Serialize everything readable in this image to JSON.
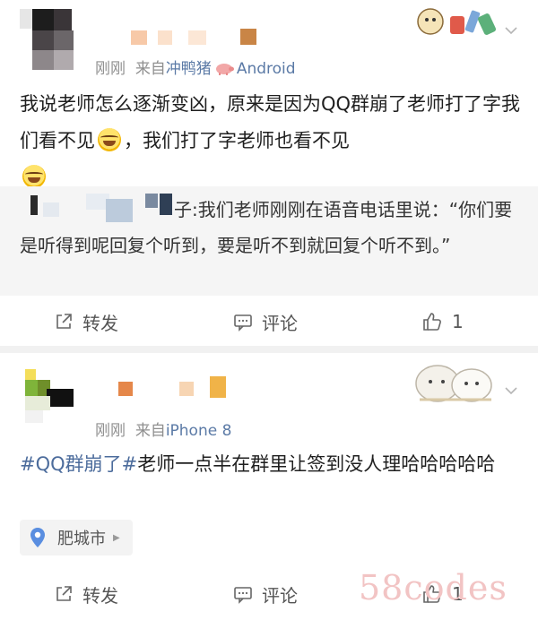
{
  "post1": {
    "timestamp": "刚刚",
    "source_prefix": "来自",
    "source_name": "冲鸭猪",
    "source_device": "Android",
    "text_part1": "我说老师怎么逐渐变凶，原来是因为QQ群崩了老师打了字我们看不见",
    "text_part2": "，我们打了字老师也看不见",
    "emoji": "laugh-cry-icon",
    "repost_text": "子:我们老师刚刚在语音电话里说：“你们要是听得到呢回复个听到，要是听不到就回复个听不到。”",
    "actions": {
      "repost": "转发",
      "comment": "评论",
      "like": "赞",
      "like_count": "1"
    }
  },
  "post2": {
    "timestamp": "刚刚",
    "source_prefix": "来自",
    "source_device": "iPhone 8",
    "topic": "#QQ群崩了#",
    "text": "老师一点半在群里让签到没人理哈哈哈哈哈",
    "location": "肥城市",
    "actions": {
      "repost": "转发",
      "comment": "评论",
      "like_count": "1"
    }
  },
  "watermark": "58codes",
  "colors": {
    "link": "#4c6c9c",
    "meta": "#8f8f8f",
    "divider": "#f1f1f1"
  }
}
